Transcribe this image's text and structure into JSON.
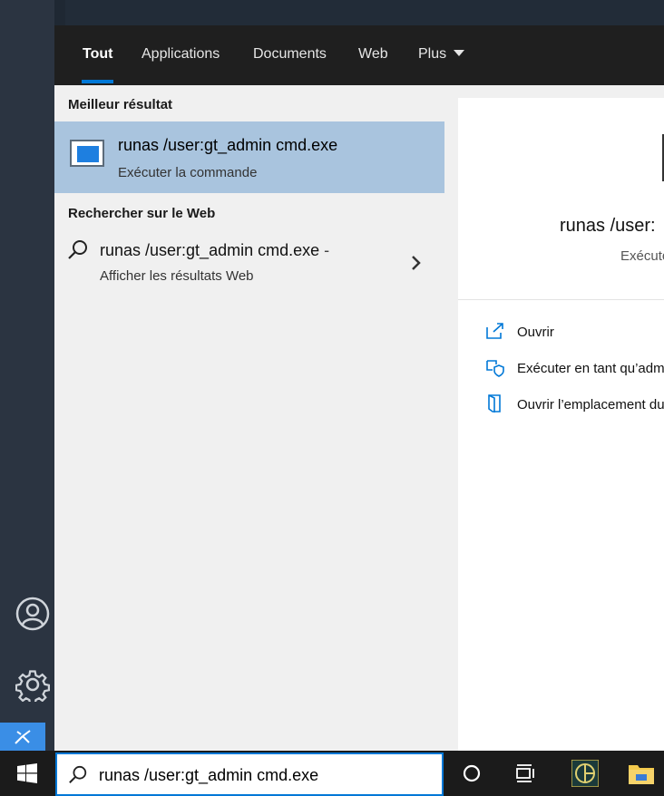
{
  "tabs": [
    {
      "label": "Tout",
      "active": true
    },
    {
      "label": "Applications"
    },
    {
      "label": "Documents"
    },
    {
      "label": "Web"
    },
    {
      "label": "Plus"
    }
  ],
  "best_match": {
    "heading": "Meilleur résultat",
    "title": "runas /user:gt_admin cmd.exe",
    "subtitle": "Exécuter la commande",
    "icon": "console-window-icon"
  },
  "web_search": {
    "heading": "Rechercher sur le Web",
    "title": "runas /user:gt_admin cmd.exe",
    "dash": "-",
    "subtitle": "Afficher les résultats Web"
  },
  "preview": {
    "title": "runas /user:",
    "subtitle": "Exécuto",
    "actions": [
      {
        "label": "Ouvrir",
        "icon": "open-icon"
      },
      {
        "label": "Exécuter en tant qu’admi",
        "icon": "shield-icon"
      },
      {
        "label": "Ouvrir l’emplacement du",
        "icon": "folder-location-icon"
      }
    ]
  },
  "search": {
    "value": "runas /user:gt_admin cmd.exe"
  },
  "colors": {
    "accent": "#0078d7",
    "selected_row": "#a9c4de",
    "tabbar": "#1f1f1f"
  }
}
